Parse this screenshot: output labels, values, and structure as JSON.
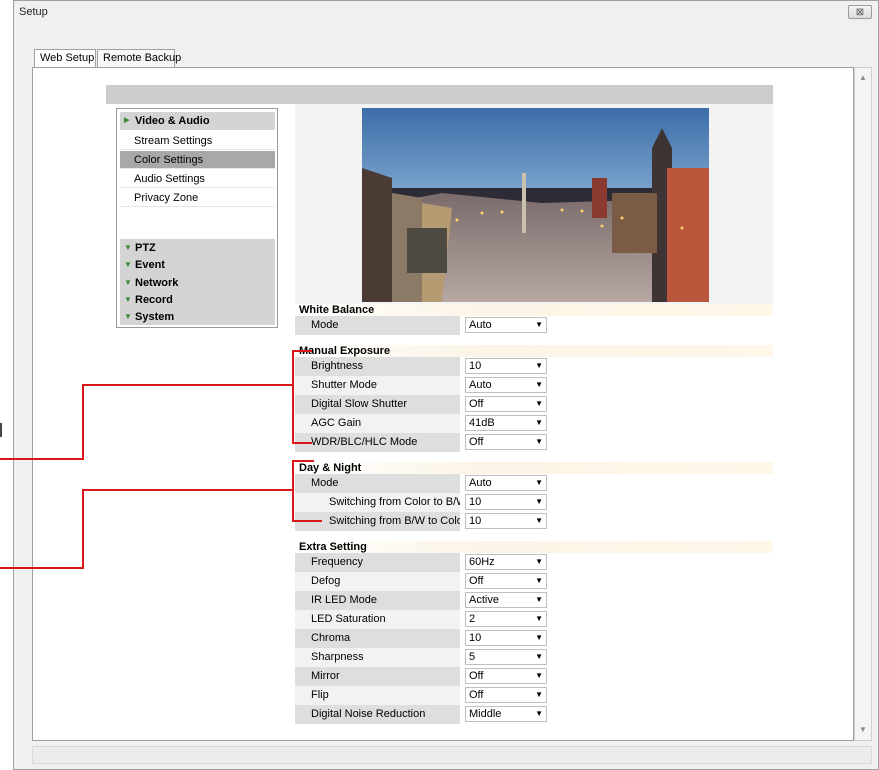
{
  "window": {
    "title": "Setup",
    "close_label": "⊠"
  },
  "tabs": [
    {
      "label": "Web Setup",
      "active": true
    },
    {
      "label": "Remote Backup",
      "active": false
    }
  ],
  "sidebar": {
    "active_section": "Video & Audio",
    "sub_items": [
      {
        "label": "Stream Settings",
        "active": false
      },
      {
        "label": "Color Settings",
        "active": true
      },
      {
        "label": "Audio Settings",
        "active": false
      },
      {
        "label": "Privacy Zone",
        "active": false
      }
    ],
    "collapsed": [
      "PTZ",
      "Event",
      "Network",
      "Record",
      "System"
    ]
  },
  "white_balance": {
    "title": "White Balance",
    "rows": [
      {
        "label": "Mode",
        "value": "Auto"
      }
    ]
  },
  "manual_exposure": {
    "title": "Manual Exposure",
    "rows": [
      {
        "label": "Brightness",
        "value": "10"
      },
      {
        "label": "Shutter Mode",
        "value": "Auto"
      },
      {
        "label": "Digital Slow Shutter",
        "value": "Off"
      },
      {
        "label": "AGC Gain",
        "value": "41dB"
      },
      {
        "label": "WDR/BLC/HLC Mode",
        "value": "Off"
      }
    ]
  },
  "day_night": {
    "title": "Day & Night",
    "rows": [
      {
        "label": "Mode",
        "value": "Auto"
      },
      {
        "label": "Switching from Color to B/W",
        "value": "10"
      },
      {
        "label": "Switching from B/W to Color",
        "value": "10"
      }
    ]
  },
  "extra_setting": {
    "title": "Extra Setting",
    "rows": [
      {
        "label": "Frequency",
        "value": "60Hz"
      },
      {
        "label": "Defog",
        "value": "Off"
      },
      {
        "label": "IR LED Mode",
        "value": "Active"
      },
      {
        "label": "LED Saturation",
        "value": "2"
      },
      {
        "label": "Chroma",
        "value": "10"
      },
      {
        "label": "Sharpness",
        "value": "5"
      },
      {
        "label": "Mirror",
        "value": "Off"
      },
      {
        "label": "Flip",
        "value": "Off"
      },
      {
        "label": "Digital Noise Reduction",
        "value": "Middle"
      }
    ]
  },
  "colors": {
    "annotation": "#d6181a",
    "selected_nav": "#a8a8a8",
    "section_bg": "#d4d4d4"
  }
}
